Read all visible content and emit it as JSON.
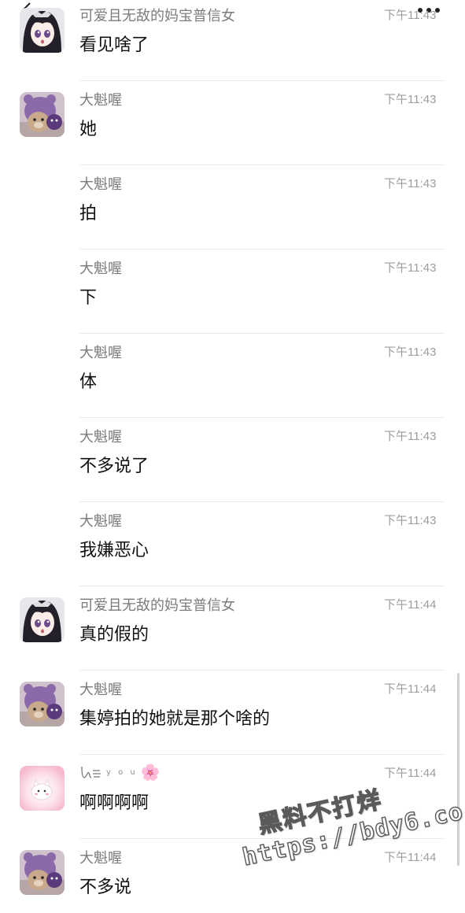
{
  "header": {
    "back_icon": "chevron-left-icon",
    "more_icon": "ellipsis-icon"
  },
  "messages": [
    {
      "sender": "可爱且无敌的妈宝普信女",
      "time": "下午11:43",
      "text": "看见啥了",
      "avatar": "anime-girl"
    },
    {
      "sender": "大魁喔",
      "time": "下午11:43",
      "text": "她",
      "avatar": "teddy-bear"
    },
    {
      "sender": "大魁喔",
      "time": "下午11:43",
      "text": "拍",
      "avatar": "none"
    },
    {
      "sender": "大魁喔",
      "time": "下午11:43",
      "text": "下",
      "avatar": "none"
    },
    {
      "sender": "大魁喔",
      "time": "下午11:43",
      "text": "体",
      "avatar": "none"
    },
    {
      "sender": "大魁喔",
      "time": "下午11:43",
      "text": "不多说了",
      "avatar": "none"
    },
    {
      "sender": "大魁喔",
      "time": "下午11:43",
      "text": "我嫌恶心",
      "avatar": "none"
    },
    {
      "sender": "可爱且无敌的妈宝普信女",
      "time": "下午11:44",
      "text": "真的假的",
      "avatar": "anime-girl"
    },
    {
      "sender": "大魁喔",
      "time": "下午11:44",
      "text": "集婷拍的她就是那个啥的",
      "avatar": "teddy-bear"
    },
    {
      "sender": "y o u",
      "sender_flower": "🌸",
      "time": "下午11:44",
      "text": "啊啊啊啊",
      "avatar": "pink-cat"
    },
    {
      "sender": "大魁喔",
      "time": "下午11:44",
      "text": "不多说",
      "avatar": "teddy-bear"
    }
  ],
  "watermark": {
    "line1": "黑料不打烊",
    "line2": "https://bdy6.co"
  },
  "colors": {
    "background": "#ffffff",
    "sender": "#7b7b7b",
    "time": "#9d9d9d",
    "text": "#111111",
    "divider": "#e9e9e9"
  }
}
